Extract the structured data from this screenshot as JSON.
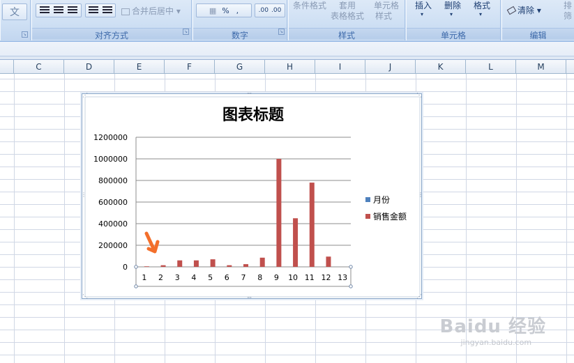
{
  "ribbon": {
    "wrap_icon_text": "文",
    "merge_label": "合并后居中",
    "alignment_group": "对齐方式",
    "number_group": "数字",
    "percent_label": "%",
    "comma_label": ",",
    "inc_decimal_label": ".00",
    "dec_decimal_label": ".00",
    "conditional_format": "条件格式",
    "format_as_table_1": "套用",
    "format_as_table_2": "表格格式",
    "cell_styles_1": "单元格",
    "cell_styles_2": "样式",
    "styles_group": "样式",
    "insert_label": "插入",
    "delete_label": "删除",
    "format_label": "格式",
    "cells_group": "单元格",
    "clear_label": "清除",
    "sort_label_1": "排",
    "sort_label_2": "筛",
    "editing_group": "编辑"
  },
  "columns": [
    "C",
    "D",
    "E",
    "F",
    "G",
    "H",
    "I",
    "J",
    "K",
    "L",
    "M"
  ],
  "chart_data": {
    "type": "bar",
    "title": "图表标题",
    "categories": [
      "1",
      "2",
      "3",
      "4",
      "5",
      "6",
      "7",
      "8",
      "9",
      "10",
      "11",
      "12",
      "13"
    ],
    "series": [
      {
        "name": "月份",
        "color": "#4f81bd",
        "values": [
          1,
          2,
          3,
          4,
          5,
          6,
          7,
          8,
          9,
          10,
          11,
          12,
          13
        ]
      },
      {
        "name": "销售金额",
        "color": "#c0504d",
        "values": [
          5000,
          15000,
          60000,
          60000,
          70000,
          15000,
          25000,
          85000,
          1000000,
          450000,
          780000,
          95000,
          0
        ]
      }
    ],
    "yticks": [
      "0",
      "200000",
      "400000",
      "600000",
      "800000",
      "1000000",
      "1200000"
    ],
    "ylim": [
      0,
      1200000
    ],
    "legend_position": "right",
    "grid": true
  },
  "watermark": {
    "main": "Baidu 经验",
    "sub": "jingyan.baidu.com"
  }
}
